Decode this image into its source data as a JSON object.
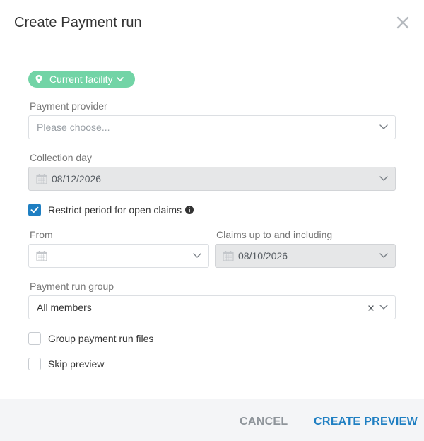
{
  "dialog": {
    "title": "Create Payment run"
  },
  "facility": {
    "label": "Current facility"
  },
  "payment_provider": {
    "label": "Payment provider",
    "placeholder": "Please choose..."
  },
  "collection_day": {
    "label": "Collection day",
    "value": "08/12/2026"
  },
  "restrict_period": {
    "label": "Restrict period for open claims",
    "checked": true
  },
  "from": {
    "label": "From",
    "value": ""
  },
  "claims_up_to": {
    "label": "Claims up to and including",
    "value": "08/10/2026"
  },
  "payment_run_group": {
    "label": "Payment run group",
    "value": "All members"
  },
  "group_files": {
    "label": "Group payment run files",
    "checked": false
  },
  "skip_preview": {
    "label": "Skip preview",
    "checked": false
  },
  "footer": {
    "cancel_label": "CANCEL",
    "create_preview_label": "CREATE PREVIEW"
  },
  "colors": {
    "accent": "#1f7fc2",
    "facility_pill": "#72d4a6",
    "disabled_field": "#e6e7e8"
  },
  "icons": {
    "close": "close-icon",
    "pin": "location-pin-icon",
    "calendar": "calendar-icon",
    "chevron": "chevron-down-icon",
    "info": "info-icon",
    "clear": "clear-icon",
    "check": "checkmark-icon"
  }
}
